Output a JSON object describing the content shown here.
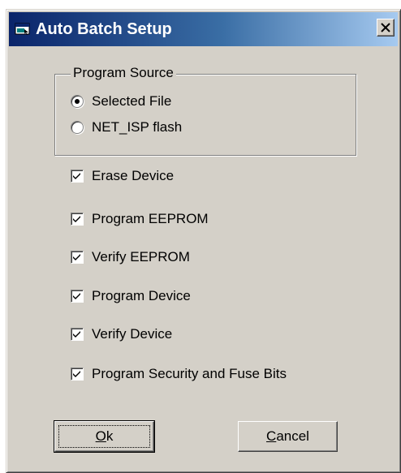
{
  "window": {
    "title": "Auto Batch Setup",
    "close_glyph": "×",
    "icon": "app-window-icon"
  },
  "program_source": {
    "legend": "Program Source",
    "options": [
      {
        "label": "Selected File",
        "selected": true
      },
      {
        "label": "NET_ISP flash",
        "selected": false
      }
    ]
  },
  "options": [
    {
      "label": "Erase Device",
      "checked": true
    },
    {
      "label": "Program EEPROM",
      "checked": true
    },
    {
      "label": "Verify EEPROM",
      "checked": true
    },
    {
      "label": "Program Device",
      "checked": true
    },
    {
      "label": "Verify Device",
      "checked": true
    },
    {
      "label": "Program Security and Fuse Bits",
      "checked": true
    }
  ],
  "buttons": {
    "ok": {
      "mnemonic": "O",
      "rest": "k"
    },
    "cancel": {
      "mnemonic": "C",
      "rest": "ancel"
    }
  },
  "colors": {
    "titlebar_start": "#0a246a",
    "titlebar_end": "#a6caf0",
    "face": "#d4d0c8"
  }
}
